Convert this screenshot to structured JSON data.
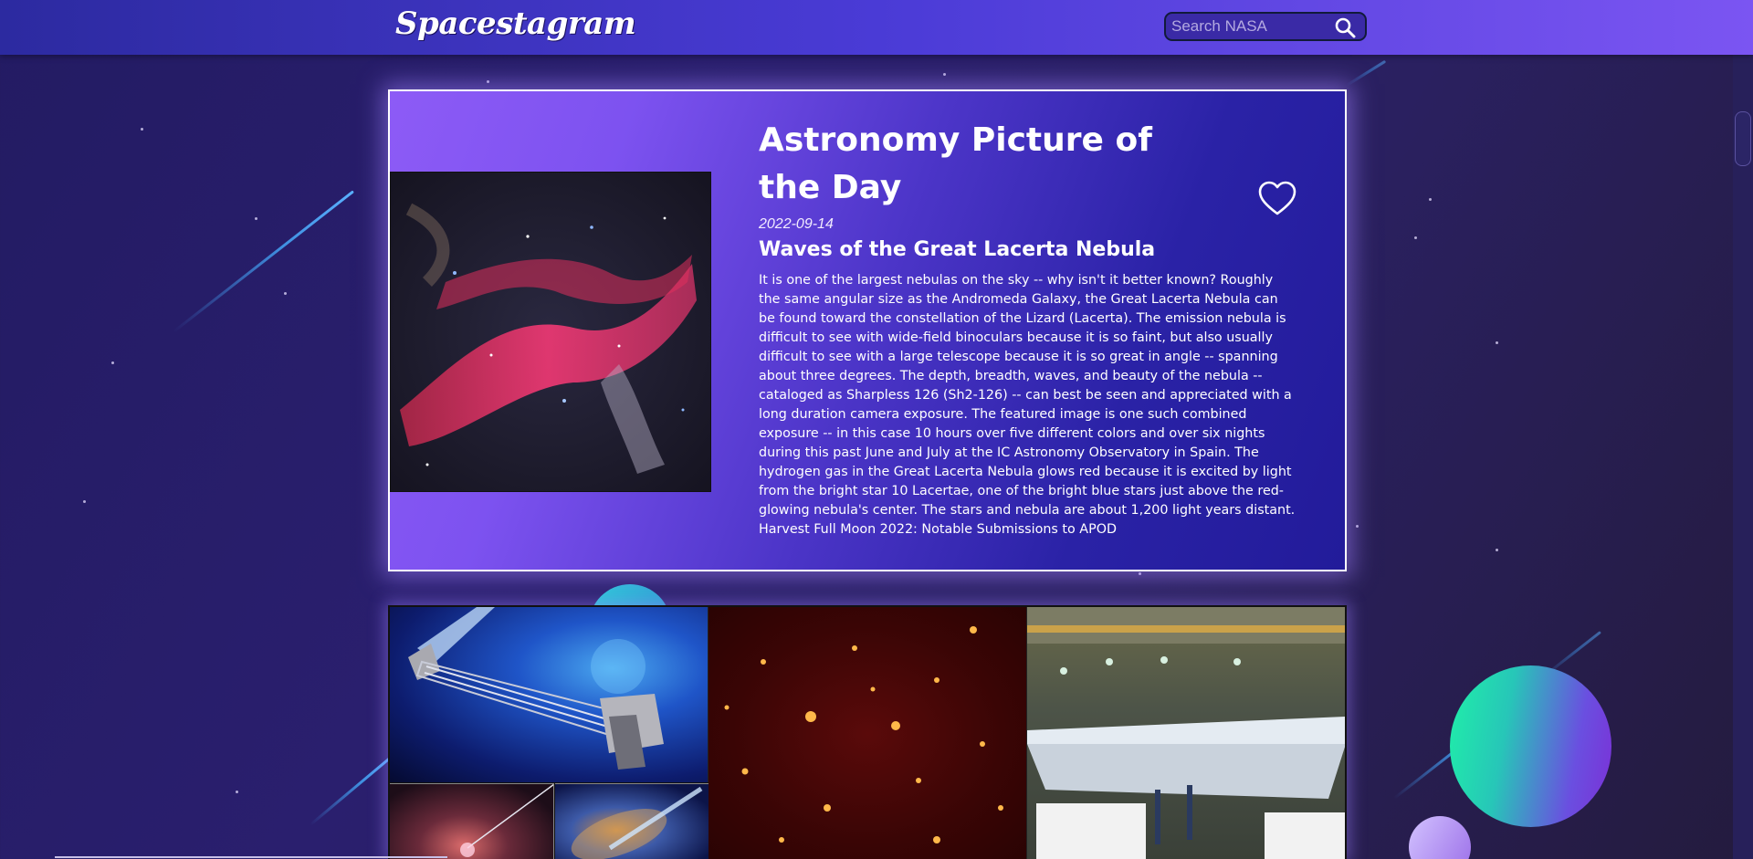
{
  "header": {
    "logo": "Spacestagram",
    "search": {
      "placeholder": "Search NASA",
      "value": ""
    }
  },
  "apod": {
    "heading": "Astronomy Picture of the Day",
    "date": "2022-09-14",
    "title": "Waves of the Great Lacerta Nebula",
    "description": "It is one of the largest nebulas on the sky -- why isn't it better known? Roughly the same angular size as the Andromeda Galaxy, the Great Lacerta Nebula can be found toward the constellation of the Lizard (Lacerta). The emission nebula is difficult to see with wide-field binoculars because it is so faint, but also usually difficult to see with a large telescope because it is so great in angle -- spanning about three degrees. The depth, breadth, waves, and beauty of the nebula -- cataloged as Sharpless 126 (Sh2-126) -- can best be seen and appreciated with a long duration camera exposure. The featured image is one such combined exposure -- in this case 10 hours over five different colors and over six nights during this past June and July at the IC Astronomy Observatory in Spain. The hydrogen gas in the Great Lacerta Nebula glows red because it is excited by light from the bright star 10 Lacertae, one of the bright blue stars just above the red-glowing nebula's center. The stars and nebula are about 1,200 light years distant. Harvest Full Moon 2022: Notable Submissions to APOD",
    "like_icon": "heart-outline-icon",
    "image_icon": "nebula-image"
  },
  "gallery": {
    "tiles": [
      {
        "name": "spacecraft-telescope-image"
      },
      {
        "name": "star-field-image"
      },
      {
        "name": "hangar-aircraft-image"
      },
      {
        "name": "nebula-jet-image"
      },
      {
        "name": "galaxy-jet-image"
      }
    ]
  },
  "colors": {
    "header_start": "#2c2aa0",
    "header_end": "#7b55f2",
    "card_purple": "#8d5bf6",
    "card_blue": "#221b9a",
    "background": "#231b63"
  }
}
